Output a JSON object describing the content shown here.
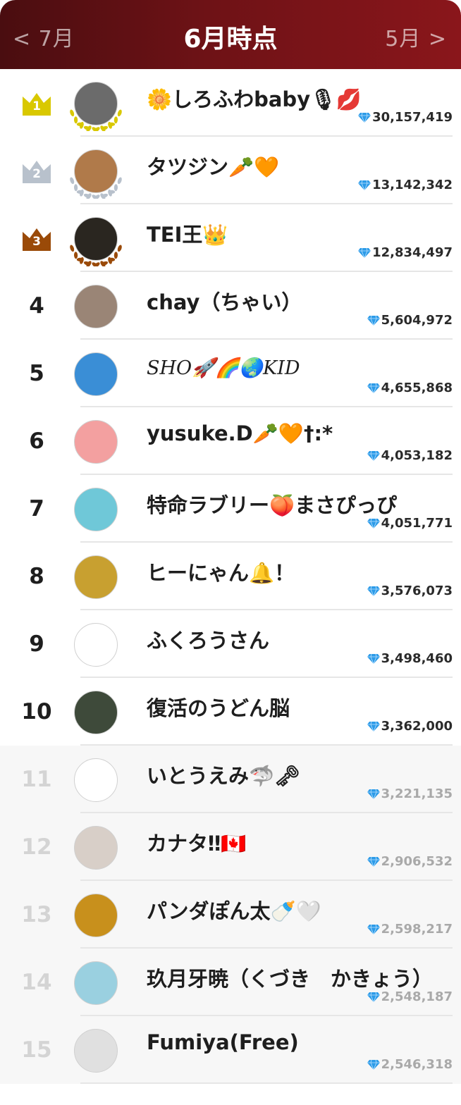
{
  "header": {
    "prev_label": "< 7月",
    "title": "6月時点",
    "next_label": "5月 >",
    "gradient_colors": [
      "#4a0d10",
      "#8a161b"
    ]
  },
  "colors": {
    "gold": "#d9c800",
    "silver": "#b8c1cc",
    "bronze": "#9a4a08",
    "faded_rank": "#d4d4d4",
    "gem": "#2c9be8"
  },
  "ranking": [
    {
      "rank": "1",
      "name": "🌼しろふわbaby🎙💋",
      "score": "30,157,419",
      "crown": "gold",
      "avatar_color": "#6b6b6b"
    },
    {
      "rank": "2",
      "name": "タツジン🥕🧡",
      "score": "13,142,342",
      "crown": "silver",
      "avatar_color": "#b07a4a"
    },
    {
      "rank": "3",
      "name": "TEI王👑",
      "score": "12,834,497",
      "crown": "bronze",
      "avatar_color": "#2a2620"
    },
    {
      "rank": "4",
      "name": "chay（ちゃい）",
      "score": "5,604,972",
      "avatar_color": "#9a8576"
    },
    {
      "rank": "5",
      "name": "SHO🚀🌈🌏KID",
      "score": "4,655,868",
      "avatar_color": "#3a8ed6",
      "italic": true
    },
    {
      "rank": "6",
      "name": "yusuke.D🥕🧡†:*",
      "score": "4,053,182",
      "avatar_color": "#f3a0a0"
    },
    {
      "rank": "7",
      "name": "特命ラブリー🍑まさぴっぴ",
      "score": "4,051,771",
      "avatar_color": "#6fc8d8"
    },
    {
      "rank": "8",
      "name": "ヒーにゃん🔔！",
      "score": "3,576,073",
      "avatar_color": "#c8a030"
    },
    {
      "rank": "9",
      "name": "ふくろうさん",
      "score": "3,498,460",
      "avatar_color": "#ffffff"
    },
    {
      "rank": "10",
      "name": "復活のうどん脳",
      "score": "3,362,000",
      "avatar_color": "#3e4a3a"
    },
    {
      "rank": "11",
      "name": "いとうえみ🦈🗝",
      "score": "3,221,135",
      "avatar_color": "#ffffff",
      "faded": true
    },
    {
      "rank": "12",
      "name": "カナタ‼🇨🇦",
      "score": "2,906,532",
      "avatar_color": "#d8cfc8",
      "faded": true
    },
    {
      "rank": "13",
      "name": "パンダぽん太🍼🤍",
      "score": "2,598,217",
      "avatar_color": "#c8901c",
      "faded": true
    },
    {
      "rank": "14",
      "name": "玖月牙暁（くづき　かきょう）",
      "score": "2,548,187",
      "avatar_color": "#9ad0e0",
      "faded": true
    },
    {
      "rank": "15",
      "name": "Fumiya(Free)",
      "score": "2,546,318",
      "avatar_color": "#e0e0e0",
      "faded": true
    }
  ]
}
